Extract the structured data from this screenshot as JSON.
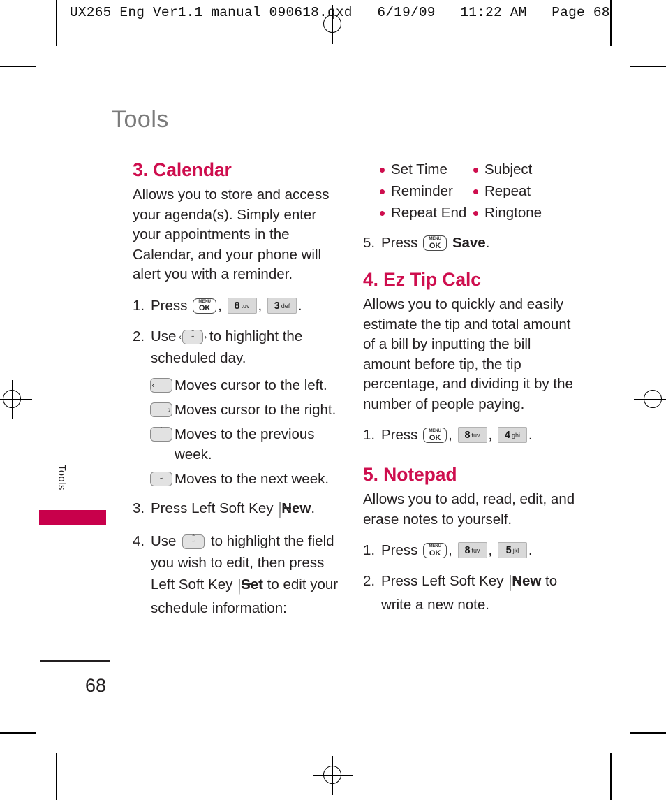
{
  "prepress": {
    "slug": "UX265_Eng_Ver1.1_manual_090618.qxd   6/19/09   11:22 AM   Page 68"
  },
  "page": {
    "chapter_title": "Tools",
    "side_tab_label": "Tools",
    "page_number": "68",
    "accent_color": "#ce0e4e",
    "tab_color": "#c8004b",
    "title_color": "#7b7b7b"
  },
  "sections": {
    "calendar": {
      "heading": "3. Calendar",
      "intro": "Allows you to store and access your agenda(s). Simply enter your appointments in the Calendar, and your phone will alert you with a reminder.",
      "step1": {
        "num": "1.",
        "verb": "Press",
        "keys": [
          {
            "type": "menuok",
            "line1": "MENU",
            "line2": "OK"
          },
          {
            "type": "num",
            "digit": "8",
            "letters": "tuv"
          },
          {
            "type": "num",
            "digit": "3",
            "letters": "def"
          }
        ],
        "trail": "."
      },
      "step2": {
        "num": "2.",
        "verb": "Use",
        "key": {
          "type": "nav4",
          "icon": "dpad-4way-icon"
        },
        "text": "to highlight the scheduled day."
      },
      "key_explanations": [
        {
          "icon": "nav-left-icon",
          "dir": "left",
          "text": "Moves cursor to the left."
        },
        {
          "icon": "nav-right-icon",
          "dir": "right",
          "text": "Moves cursor to the right."
        },
        {
          "icon": "nav-up-icon",
          "dir": "up",
          "text": "Moves to the previous week."
        },
        {
          "icon": "nav-down-icon",
          "dir": "down",
          "text": "Moves to the next week."
        }
      ],
      "step3": {
        "num": "3.",
        "pre": "Press Left Soft Key",
        "key": {
          "type": "soft",
          "icon": "left-soft-key-icon"
        },
        "bold": "New",
        "trail": "."
      },
      "step4": {
        "num": "4.",
        "pre": "Use",
        "key": {
          "type": "nav2",
          "icon": "dpad-updown-icon"
        },
        "mid": "to highlight the field you wish to edit, then press Left Soft Key",
        "key2": {
          "type": "soft",
          "icon": "left-soft-key-icon"
        },
        "bold": "Set",
        "post": "to edit your schedule information:"
      },
      "fields": [
        "Set Time",
        "Subject",
        "Reminder",
        "Repeat",
        "Repeat End",
        "Ringtone"
      ],
      "step5": {
        "num": "5.",
        "verb": "Press",
        "key": {
          "type": "menuok",
          "line1": "MENU",
          "line2": "OK"
        },
        "bold": "Save",
        "trail": "."
      }
    },
    "ez_tip_calc": {
      "heading": "4. Ez Tip Calc",
      "intro": "Allows you to quickly and easily estimate the tip and total amount of a bill by inputting the bill amount before tip, the tip percentage, and dividing it by the number of people paying.",
      "step1": {
        "num": "1.",
        "verb": "Press",
        "keys": [
          {
            "type": "menuok",
            "line1": "MENU",
            "line2": "OK"
          },
          {
            "type": "num",
            "digit": "8",
            "letters": "tuv"
          },
          {
            "type": "num",
            "digit": "4",
            "letters": "ghi"
          }
        ],
        "trail": "."
      }
    },
    "notepad": {
      "heading": "5. Notepad",
      "intro": "Allows you to add, read, edit, and erase notes to yourself.",
      "step1": {
        "num": "1.",
        "verb": "Press",
        "keys": [
          {
            "type": "menuok",
            "line1": "MENU",
            "line2": "OK"
          },
          {
            "type": "num",
            "digit": "8",
            "letters": "tuv"
          },
          {
            "type": "num",
            "digit": "5",
            "letters": "jkl"
          }
        ],
        "trail": "."
      },
      "step2": {
        "num": "2.",
        "pre": "Press Left Soft Key",
        "key": {
          "type": "soft",
          "icon": "left-soft-key-icon"
        },
        "bold": "New",
        "post": "to write a new note."
      }
    }
  }
}
